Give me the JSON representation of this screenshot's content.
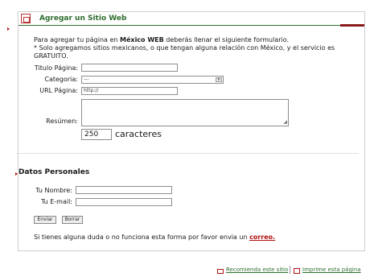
{
  "header": {
    "title": "Agregar un Sitio Web"
  },
  "intro": {
    "line1_pre": "Para agregar tu página en ",
    "line1_bold": "México WEB",
    "line1_post": " deberás llenar el siguiente formulario.",
    "line2": "* Solo agregamos sitios mexicanos, o que tengan alguna relación con México, y el servicio es GRATUITO."
  },
  "form": {
    "titulo_label": "Titulo Página:",
    "titulo_value": "",
    "categoria_label": "Categoria:",
    "categoria_value": "---",
    "url_label": "URL Página:",
    "url_value": "http://",
    "resumen_label": "Resúmen:",
    "counter_value": "250",
    "counter_label": "caracteres"
  },
  "personal": {
    "section_title": "Datos Personales",
    "nombre_label": "Tu Nombre:",
    "nombre_value": "",
    "email_label": "Tu E-mail:",
    "email_value": ""
  },
  "buttons": {
    "enviar": "Enviar",
    "borrar": "Borrar"
  },
  "contact": {
    "text": "Si tienes alguna duda o no funciona esta forma por favor envia un ",
    "link": "correo."
  },
  "footer": {
    "recomienda": "Recomienda este sitio",
    "imprime": "Imprime esta página"
  },
  "colors": {
    "accent_green": "#2f6e2f",
    "accent_red": "#b01010"
  }
}
